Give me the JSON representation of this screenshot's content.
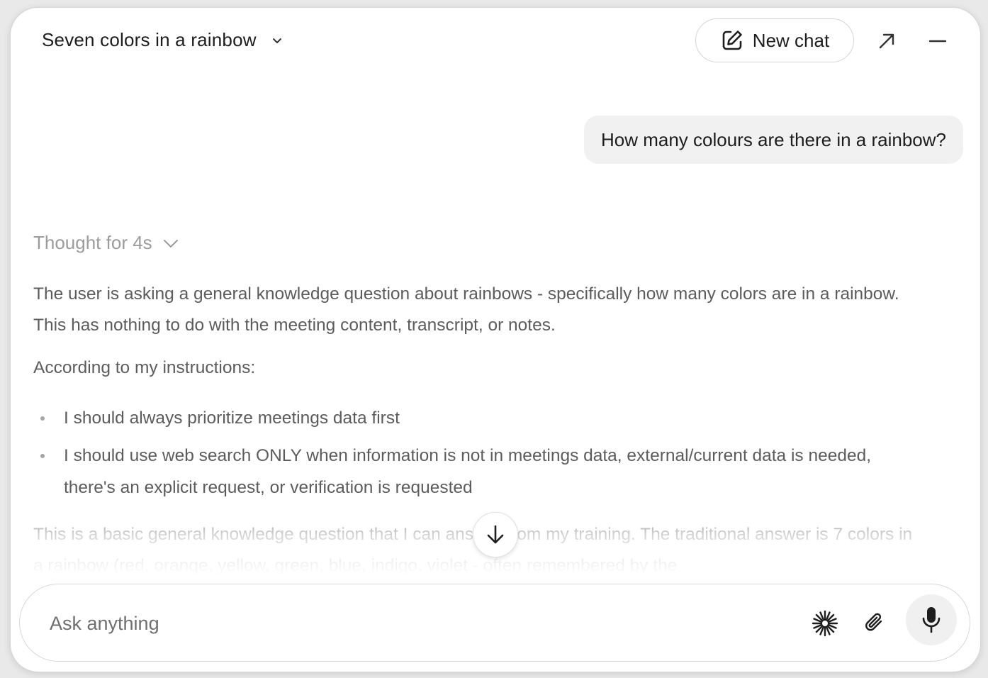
{
  "header": {
    "title": "Seven colors in a rainbow",
    "new_chat_label": "New chat"
  },
  "icons": {
    "title_dropdown": "chevron-down-icon",
    "new_chat": "pencil-square-icon",
    "expand": "arrow-up-right-icon",
    "minimize": "minus-icon",
    "thought_toggle": "chevron-down-icon",
    "scroll_down": "arrow-down-icon",
    "spark": "asterisk-spark-icon",
    "attach": "paperclip-icon",
    "mic": "microphone-icon"
  },
  "messages": {
    "user_question": "How many colours are there in a rainbow?",
    "thought_label": "Thought for 4s",
    "paragraphs": [
      "The user is asking a general knowledge question about rainbows - specifically how many colors are in a rainbow. This has nothing to do with the meeting content, transcript, or notes.",
      "According to my instructions:"
    ],
    "bullets": [
      "I should always prioritize meetings data first",
      "I should use web search ONLY when information is not in meetings data, external/current data is needed, there's an explicit request, or verification is requested"
    ],
    "trailing_paragraph": "This is a basic general knowledge question that I can answer from my training. The traditional answer is 7 colors in a rainbow (red, orange, yellow, green, blue, indigo, violet - often remembered by the"
  },
  "composer": {
    "placeholder": "Ask anything"
  },
  "colors": {
    "background": "#ffffff",
    "text_primary": "#1d1d1d",
    "text_secondary": "#5c5c5c",
    "text_muted": "#9c9c9c",
    "bubble": "#f1f1f1"
  }
}
